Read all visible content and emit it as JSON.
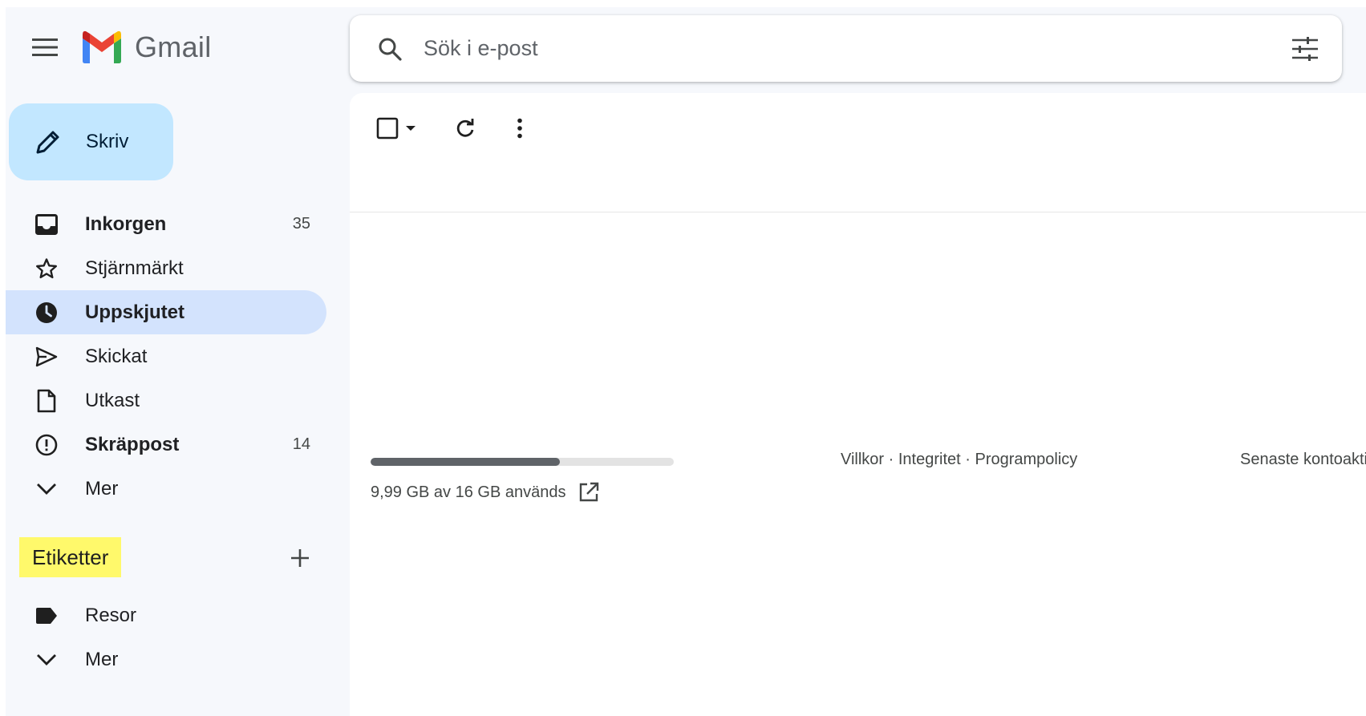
{
  "header": {
    "app_name": "Gmail",
    "search_placeholder": "Sök i e-post"
  },
  "compose": {
    "label": "Skriv"
  },
  "nav": {
    "items": [
      {
        "label": "Inkorgen",
        "count": "35",
        "icon": "inbox-icon",
        "bold": true,
        "active": false
      },
      {
        "label": "Stjärnmärkt",
        "count": "",
        "icon": "star-icon",
        "bold": false,
        "active": false
      },
      {
        "label": "Uppskjutet",
        "count": "",
        "icon": "clock-icon",
        "bold": true,
        "active": true
      },
      {
        "label": "Skickat",
        "count": "",
        "icon": "send-icon",
        "bold": false,
        "active": false
      },
      {
        "label": "Utkast",
        "count": "",
        "icon": "draft-icon",
        "bold": false,
        "active": false
      },
      {
        "label": "Skräppost",
        "count": "14",
        "icon": "spam-icon",
        "bold": true,
        "active": false
      },
      {
        "label": "Mer",
        "count": "",
        "icon": "chevron-down-icon",
        "bold": false,
        "active": false
      }
    ]
  },
  "labels": {
    "title": "Etiketter",
    "items": [
      {
        "label": "Resor",
        "icon": "label-icon"
      },
      {
        "label": "Mer",
        "icon": "chevron-down-icon"
      }
    ]
  },
  "storage": {
    "text": "9,99 GB av 16 GB används",
    "used_fraction": 0.624
  },
  "footer": {
    "terms": "Villkor",
    "privacy": "Integritet",
    "policy": "Programpolicy",
    "separator": " · ",
    "last_activity": "Senaste kontoaktivitet"
  },
  "colors": {
    "compose_bg": "#c2e7ff",
    "active_nav_bg": "#d3e3fd",
    "highlight": "#fff96b",
    "app_bg": "#f6f8fc"
  }
}
